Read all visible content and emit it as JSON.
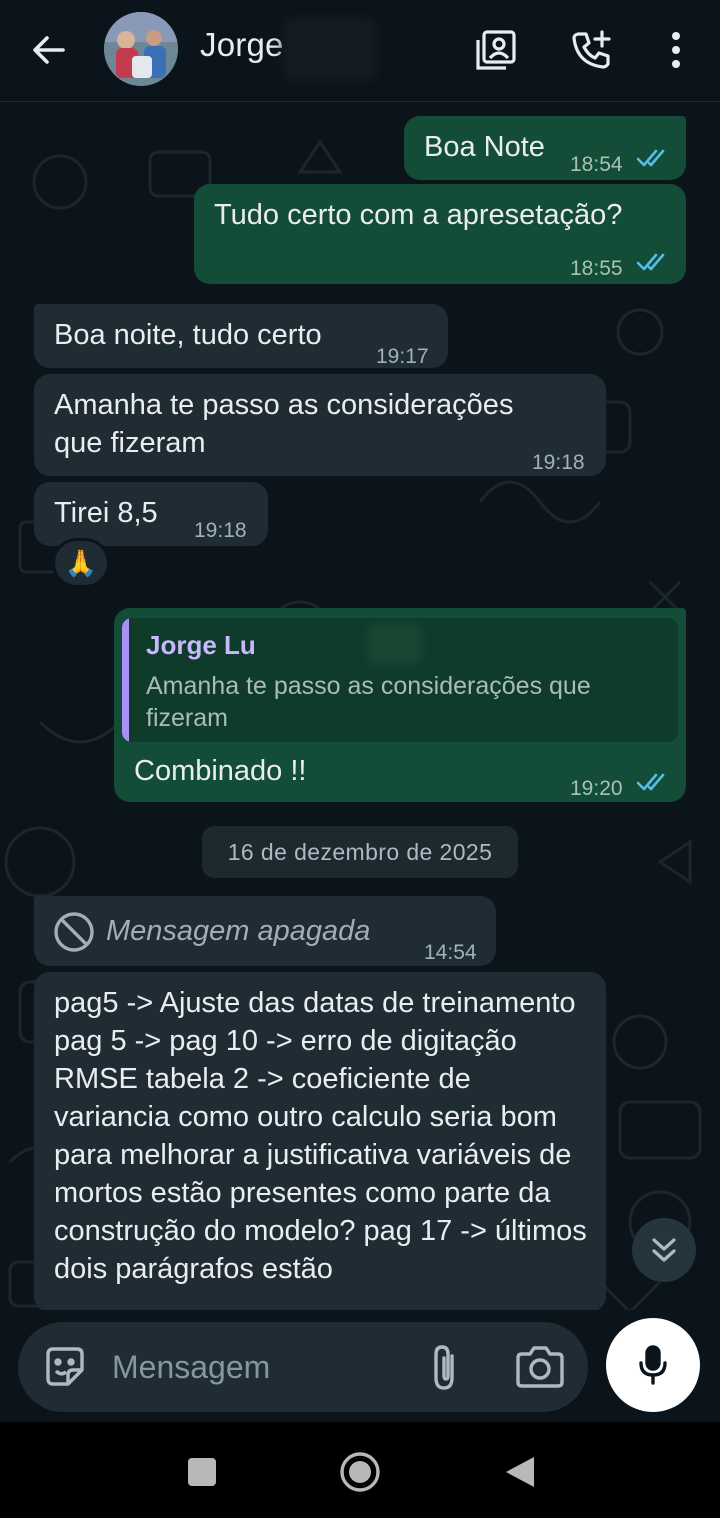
{
  "header": {
    "contact_name": "Jorge",
    "icons": [
      "back-arrow-icon",
      "contact-card-icon",
      "add-call-icon",
      "more-vert-icon"
    ]
  },
  "messages": [
    {
      "id": "m1",
      "direction": "out",
      "text": "Boa Note",
      "time": "18:54",
      "status": "read"
    },
    {
      "id": "m2",
      "direction": "out",
      "text": "Tudo certo com a apresetação?",
      "time": "18:55",
      "status": "read"
    },
    {
      "id": "m3",
      "direction": "in",
      "text": "Boa noite, tudo certo",
      "time": "19:17"
    },
    {
      "id": "m4",
      "direction": "in",
      "text_line1": "Amanha te passo as considerações",
      "text_line2": "que fizeram",
      "time": "19:18"
    },
    {
      "id": "m5",
      "direction": "in",
      "text": "Tirei 8,5",
      "time": "19:18",
      "reaction": "🙏"
    },
    {
      "id": "m6",
      "direction": "out",
      "quote_author": "Jorge Lu",
      "quote_text": "Amanha te passo as considerações que fizeram",
      "text": "Combinado !!",
      "time": "19:20",
      "status": "read"
    }
  ],
  "date_divider": "16 de dezembro de 2025",
  "deleted_message": {
    "text": "Mensagem apagada",
    "time": "14:54"
  },
  "long_message": {
    "text": "pag5 -> Ajuste das datas de treinamento pag 5 -> pag 10 -> erro de digitação RMSE tabela 2 -> coeficiente de variancia como outro calculo seria bom para melhorar a justificativa variáveis de mortos estão presentes como parte da construção do modelo? pag 17 -> últimos dois parágrafos estão"
  },
  "composer": {
    "placeholder": "Mensagem",
    "icons": [
      "emoji-sticker-icon",
      "paperclip-icon",
      "camera-icon",
      "microphone-icon"
    ]
  },
  "colors": {
    "background": "#0b141a",
    "outgoing_bubble": "#144d37",
    "incoming_bubble": "#202c33",
    "read_ticks": "#53bdeb"
  }
}
